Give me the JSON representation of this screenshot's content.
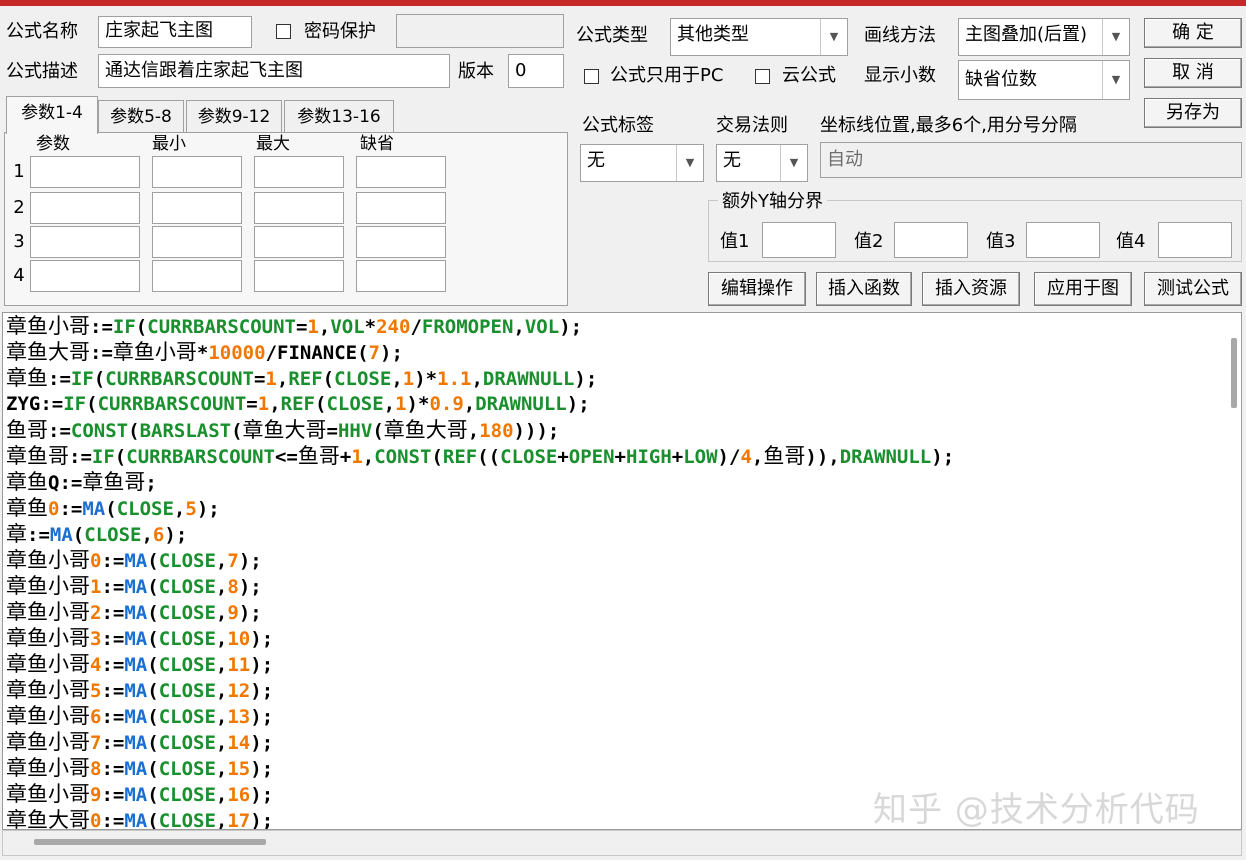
{
  "header": {
    "formula_name_label": "公式名称",
    "formula_name_value": "庄家起飞主图",
    "password_label": "密码保护",
    "formula_desc_label": "公式描述",
    "formula_desc_value": "通达信跟着庄家起飞主图",
    "version_label": "版本",
    "version_value": "0",
    "formula_type_label": "公式类型",
    "formula_type_value": "其他类型",
    "draw_method_label": "画线方法",
    "draw_method_value": "主图叠加(后置)",
    "pc_only_label": "公式只用于PC",
    "cloud_label": "云公式",
    "decimals_label": "显示小数",
    "decimals_value": "缺省位数",
    "ok_label": "确  定",
    "cancel_label": "取  消",
    "save_as_label": "另存为"
  },
  "params": {
    "tabs": [
      "参数1-4",
      "参数5-8",
      "参数9-12",
      "参数13-16"
    ],
    "col_param": "参数",
    "col_min": "最小",
    "col_max": "最大",
    "col_default": "缺省",
    "rows": [
      "1",
      "2",
      "3",
      "4"
    ]
  },
  "right_panel": {
    "tag_label": "公式标签",
    "tag_value": "无",
    "trade_rule_label": "交易法则",
    "trade_rule_value": "无",
    "coord_label": "坐标线位置,最多6个,用分号分隔",
    "coord_placeholder": "自动",
    "y_axis_group_label": "额外Y轴分界",
    "y_labels": [
      "值1",
      "值2",
      "值3",
      "值4"
    ]
  },
  "toolbar": {
    "edit_label": "编辑操作",
    "insert_func_label": "插入函数",
    "insert_res_label": "插入资源",
    "apply_label": "应用于图",
    "test_label": "测试公式"
  },
  "code_lines": [
    "章鱼小哥:=IF(CURRBARSCOUNT=1,VOL*240/FROMOPEN,VOL);",
    "章鱼大哥:=章鱼小哥*10000/FINANCE(7);",
    "章鱼:=IF(CURRBARSCOUNT=1,REF(CLOSE,1)*1.1,DRAWNULL);",
    "ZYG:=IF(CURRBARSCOUNT=1,REF(CLOSE,1)*0.9,DRAWNULL);",
    "鱼哥:=CONST(BARSLAST(章鱼大哥=HHV(章鱼大哥,180)));",
    "章鱼哥:=IF(CURRBARSCOUNT<=鱼哥+1,CONST(REF((CLOSE+OPEN+HIGH+LOW)/4,鱼哥)),DRAWNULL);",
    "章鱼Q:=章鱼哥;",
    "章鱼0:=MA(CLOSE,5);",
    "章:=MA(CLOSE,6);",
    "章鱼小哥0:=MA(CLOSE,7);",
    "章鱼小哥1:=MA(CLOSE,8);",
    "章鱼小哥2:=MA(CLOSE,9);",
    "章鱼小哥3:=MA(CLOSE,10);",
    "章鱼小哥4:=MA(CLOSE,11);",
    "章鱼小哥5:=MA(CLOSE,12);",
    "章鱼小哥6:=MA(CLOSE,13);",
    "章鱼小哥7:=MA(CLOSE,14);",
    "章鱼小哥8:=MA(CLOSE,15);",
    "章鱼小哥9:=MA(CLOSE,16);",
    "章鱼大哥0:=MA(CLOSE,17);"
  ],
  "watermark": "知乎 @技术分析代码",
  "colors": {
    "keyword": "#1a8f2e",
    "function": "#1a6fd0",
    "number": "#f07800",
    "title_bar": "#c62828"
  }
}
